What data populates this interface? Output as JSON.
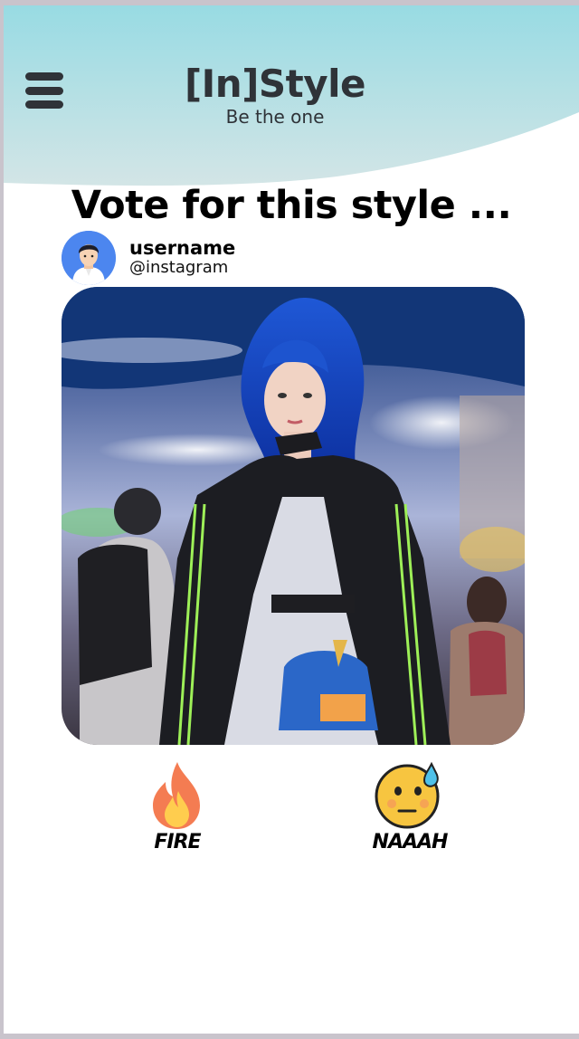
{
  "header": {
    "brand_title": "[In]Style",
    "tagline": "Be the one",
    "bg_gradient": [
      "#9adbe2",
      "#cfe3e4"
    ]
  },
  "main": {
    "title": "Vote for this style ...",
    "user": {
      "name": "username",
      "handle": "@instagram",
      "avatar_color": "#4c86ef"
    },
    "reactions": [
      {
        "icon": "fire-icon",
        "label": "FIRE"
      },
      {
        "icon": "sweat-face-icon",
        "label": "NAAAH"
      }
    ]
  }
}
